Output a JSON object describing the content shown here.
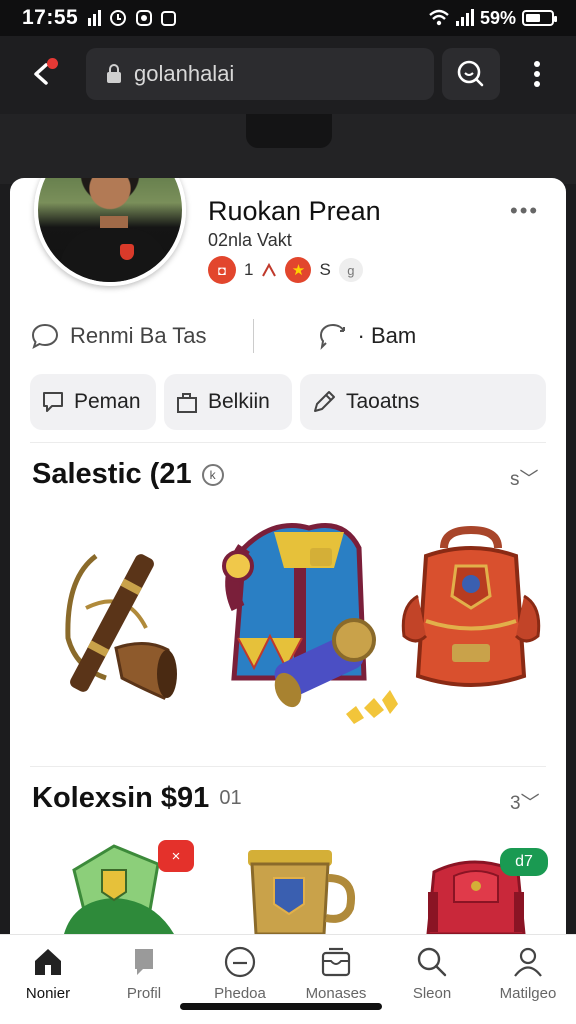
{
  "status": {
    "time": "17:55",
    "battery": "59%"
  },
  "browser": {
    "url": "golanhalai"
  },
  "profile": {
    "name": "Ruokan Prean",
    "subtitle": "02nla Vakt",
    "badge_num": "1",
    "badge_code": "S",
    "badge_g": "g"
  },
  "actions": {
    "left": "Renmi Ba Tas",
    "right": "· Bam"
  },
  "pills": [
    "Peman",
    "Belkiin",
    "Taoatns"
  ],
  "sections": [
    {
      "title": "Salestic (21",
      "icon": "k",
      "more": "s"
    },
    {
      "title": "Kolexsin $91",
      "icon": "01",
      "more": "3"
    }
  ],
  "item_badges": {
    "red": "×",
    "green": "d7"
  },
  "nav": [
    "Nonier",
    "Profil",
    "Phedoa",
    "Monases",
    "Sleon",
    "Matilgeo"
  ],
  "colors": {
    "accent_red": "#e2462d",
    "green_badge": "#1a9a52"
  }
}
